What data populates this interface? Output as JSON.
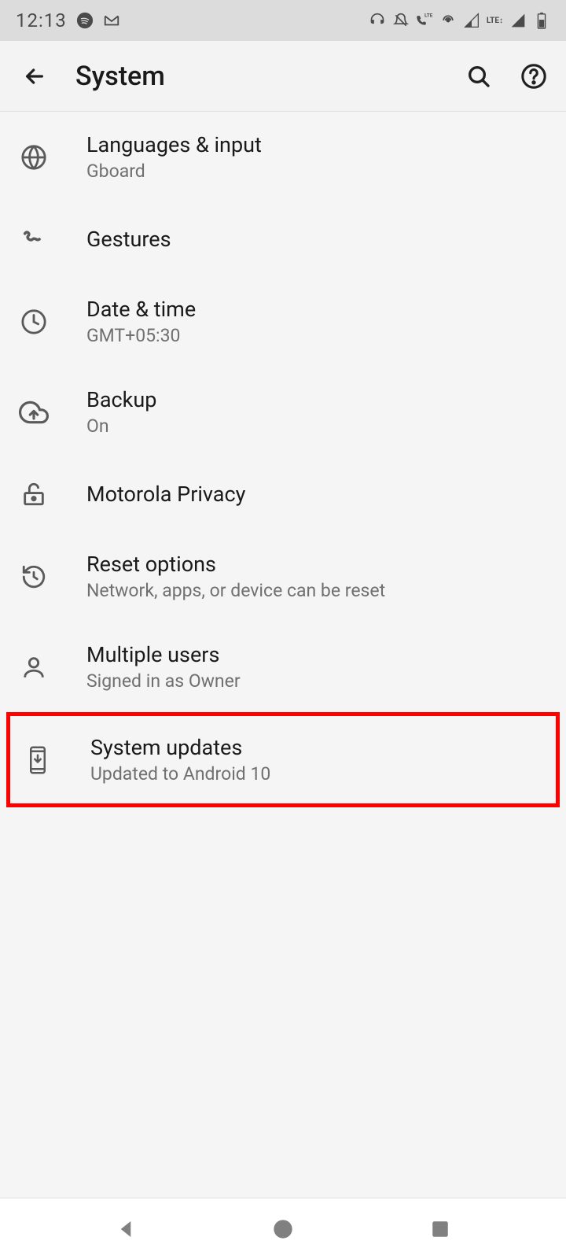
{
  "status": {
    "time": "12:13"
  },
  "header": {
    "title": "System"
  },
  "items": [
    {
      "title": "Languages & input",
      "subtitle": "Gboard"
    },
    {
      "title": "Gestures",
      "subtitle": ""
    },
    {
      "title": "Date & time",
      "subtitle": "GMT+05:30"
    },
    {
      "title": "Backup",
      "subtitle": "On"
    },
    {
      "title": "Motorola Privacy",
      "subtitle": ""
    },
    {
      "title": "Reset options",
      "subtitle": "Network, apps, or device can be reset"
    },
    {
      "title": "Multiple users",
      "subtitle": "Signed in as Owner"
    },
    {
      "title": "System updates",
      "subtitle": "Updated to Android 10"
    }
  ]
}
